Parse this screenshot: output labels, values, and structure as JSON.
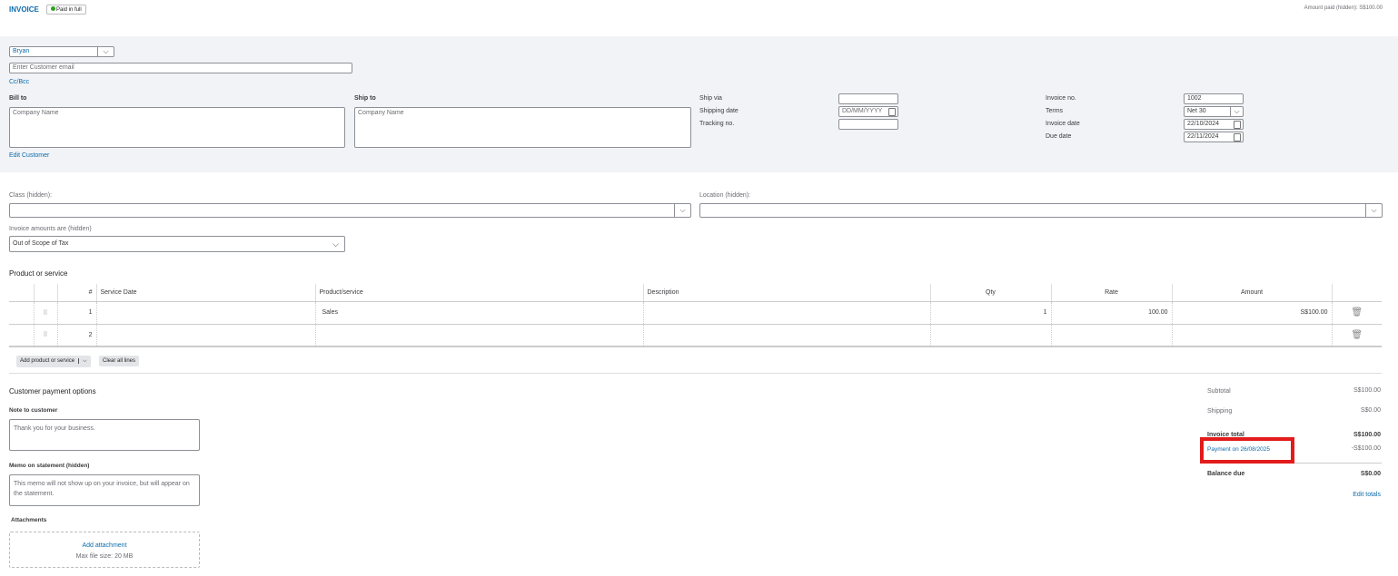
{
  "header": {
    "title": "INVOICE",
    "status": "Paid in full",
    "amount_paid": "Amount paid (hidden): S$100.00"
  },
  "customer": {
    "name": "Bryan",
    "email_placeholder": "Enter Customer email",
    "cc_bcc": "Cc/Bcc",
    "bill_to_label": "Bill to",
    "bill_to_placeholder": "Company Name",
    "ship_to_label": "Ship to",
    "ship_to_placeholder": "Company Name",
    "edit_customer": "Edit Customer"
  },
  "shipping": {
    "ship_via_label": "Ship via",
    "ship_via": "",
    "shipping_date_label": "Shipping date",
    "shipping_date_placeholder": "DD/MM/YYYY",
    "tracking_label": "Tracking no.",
    "tracking": ""
  },
  "invoice": {
    "no_label": "Invoice no.",
    "no": "1002",
    "terms_label": "Terms",
    "terms": "Net 30",
    "date_label": "Invoice date",
    "date": "22/10/2024",
    "due_label": "Due date",
    "due": "22/11/2024"
  },
  "fields": {
    "class_label": "Class (hidden):",
    "location_label": "Location (hidden):",
    "amounts_label": "Invoice amounts are (hidden)",
    "amounts": "Out of Scope of Tax"
  },
  "lines": {
    "title": "Product or service",
    "columns": [
      "#",
      "Service Date",
      "Product/service",
      "Description",
      "Qty",
      "Rate",
      "Amount"
    ],
    "rows": [
      {
        "num": "1",
        "date": "",
        "product": "Sales",
        "description": "",
        "qty": "1",
        "rate": "100.00",
        "amount": "S$100.00"
      },
      {
        "num": "2",
        "date": "",
        "product": "",
        "description": "",
        "qty": "",
        "rate": "",
        "amount": ""
      }
    ],
    "add_button": "Add product or service",
    "clear_button": "Clear all lines"
  },
  "footer": {
    "payment_options": "Customer payment options",
    "note_label": "Note to customer",
    "note": "Thank you for your business.",
    "memo_label": "Memo on statement (hidden)",
    "memo_placeholder": "This memo will not show up on your invoice, but will appear on the statement.",
    "attachments_label": "Attachments",
    "add_attachment": "Add attachment",
    "max_size": "Max file size: 20 MB"
  },
  "totals": {
    "subtotal_label": "Subtotal",
    "subtotal": "S$100.00",
    "shipping_label": "Shipping",
    "shipping": "S$0.00",
    "total_label": "Invoice total",
    "total": "S$100.00",
    "payment_label": "Payment on 26/08/2025",
    "payment": "-S$100.00",
    "balance_label": "Balance due",
    "balance": "S$0.00",
    "edit_totals": "Edit totals"
  }
}
